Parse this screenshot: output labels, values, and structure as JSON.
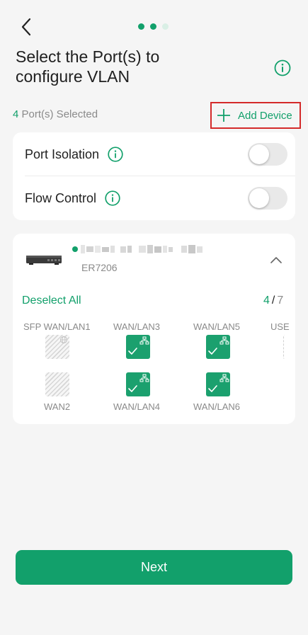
{
  "header": {
    "back_icon": "chevron-left-icon",
    "steps": [
      {
        "state": "done"
      },
      {
        "state": "active"
      },
      {
        "state": "pending"
      }
    ],
    "title_line1": "Select the Port(s) to",
    "title_line2": "configure VLAN",
    "info_icon": "info-circle-icon"
  },
  "selection": {
    "count": "4",
    "label": "Port(s) Selected",
    "add_device_label": "Add Device"
  },
  "toggles": [
    {
      "label": "Port Isolation",
      "on": false
    },
    {
      "label": "Flow Control",
      "on": false
    }
  ],
  "device": {
    "model": "ER7206",
    "status": "online",
    "deselect_label": "Deselect All",
    "selected": "4",
    "separator": "/",
    "total": "7",
    "ports": [
      {
        "label": "SFP WAN/LAN1",
        "selected": false,
        "kind": "sfp"
      },
      {
        "label": "WAN/LAN3",
        "selected": true
      },
      {
        "label": "WAN/LAN5",
        "selected": true
      },
      {
        "label": "USE",
        "selected": false
      },
      {
        "label": "WAN2",
        "selected": false
      },
      {
        "label": "WAN/LAN4",
        "selected": true
      },
      {
        "label": "WAN/LAN6",
        "selected": true
      }
    ]
  },
  "footer": {
    "next_label": "Next"
  },
  "colors": {
    "accent": "#12a06b",
    "highlight_border": "#d42a2a",
    "background": "#f5f5f5"
  }
}
